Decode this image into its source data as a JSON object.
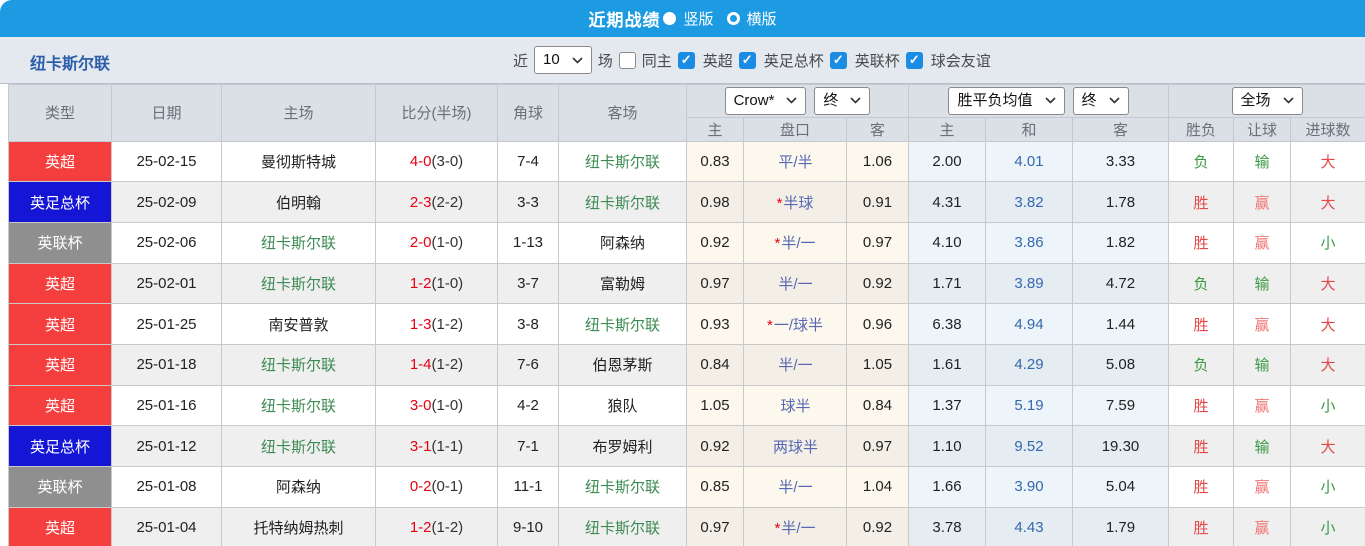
{
  "title_bar": {
    "title": "近期战绩",
    "vertical_label": "竖版",
    "horizontal_label": "横版"
  },
  "filter_bar": {
    "team": "纽卡斯尔联",
    "recent_label": "近",
    "recent_value": "10",
    "games_label": "场",
    "same_home_label": "同主",
    "competitions": [
      "英超",
      "英足总杯",
      "英联杯",
      "球会友谊"
    ]
  },
  "table": {
    "selects": {
      "company": "Crow*",
      "stage1": "终",
      "avg": "胜平负均值",
      "stage2": "终",
      "scope": "全场"
    },
    "left_headers": [
      "类型",
      "日期",
      "主场",
      "比分(半场)",
      "角球",
      "客场"
    ],
    "subheaders": [
      "主",
      "盘口",
      "客",
      "主",
      "和",
      "客",
      "胜负",
      "让球",
      "进球数"
    ],
    "rows": [
      {
        "league": "英超",
        "league_key": "premier",
        "date": "25-02-15",
        "home": "曼彻斯特城",
        "home_is_focus": false,
        "score": "4-0",
        "half": "(3-0)",
        "corners": "7-4",
        "away": "纽卡斯尔联",
        "away_is_focus": true,
        "crow_home": "0.83",
        "handicap_star": false,
        "handicap": "平/半",
        "crow_away": "1.06",
        "avg_win": "2.00",
        "avg_draw": "4.01",
        "avg_lose": "3.33",
        "result": "负",
        "handicap_result": "输",
        "goals": "大"
      },
      {
        "league": "英足总杯",
        "league_key": "facup",
        "date": "25-02-09",
        "home": "伯明翰",
        "home_is_focus": false,
        "score": "2-3",
        "half": "(2-2)",
        "corners": "3-3",
        "away": "纽卡斯尔联",
        "away_is_focus": true,
        "crow_home": "0.98",
        "handicap_star": true,
        "handicap": "半球",
        "crow_away": "0.91",
        "avg_win": "4.31",
        "avg_draw": "3.82",
        "avg_lose": "1.78",
        "result": "胜",
        "handicap_result": "赢",
        "goals": "大"
      },
      {
        "league": "英联杯",
        "league_key": "eflcup",
        "date": "25-02-06",
        "home": "纽卡斯尔联",
        "home_is_focus": true,
        "score": "2-0",
        "half": "(1-0)",
        "corners": "1-13",
        "away": "阿森纳",
        "away_is_focus": false,
        "crow_home": "0.92",
        "handicap_star": true,
        "handicap": "半/一",
        "crow_away": "0.97",
        "avg_win": "4.10",
        "avg_draw": "3.86",
        "avg_lose": "1.82",
        "result": "胜",
        "handicap_result": "赢",
        "goals": "小"
      },
      {
        "league": "英超",
        "league_key": "premier",
        "date": "25-02-01",
        "home": "纽卡斯尔联",
        "home_is_focus": true,
        "score": "1-2",
        "half": "(1-0)",
        "corners": "3-7",
        "away": "富勒姆",
        "away_is_focus": false,
        "crow_home": "0.97",
        "handicap_star": false,
        "handicap": "半/一",
        "crow_away": "0.92",
        "avg_win": "1.71",
        "avg_draw": "3.89",
        "avg_lose": "4.72",
        "result": "负",
        "handicap_result": "输",
        "goals": "大"
      },
      {
        "league": "英超",
        "league_key": "premier",
        "date": "25-01-25",
        "home": "南安普敦",
        "home_is_focus": false,
        "score": "1-3",
        "half": "(1-2)",
        "corners": "3-8",
        "away": "纽卡斯尔联",
        "away_is_focus": true,
        "crow_home": "0.93",
        "handicap_star": true,
        "handicap": "一/球半",
        "crow_away": "0.96",
        "avg_win": "6.38",
        "avg_draw": "4.94",
        "avg_lose": "1.44",
        "result": "胜",
        "handicap_result": "赢",
        "goals": "大"
      },
      {
        "league": "英超",
        "league_key": "premier",
        "date": "25-01-18",
        "home": "纽卡斯尔联",
        "home_is_focus": true,
        "score": "1-4",
        "half": "(1-2)",
        "corners": "7-6",
        "away": "伯恩茅斯",
        "away_is_focus": false,
        "crow_home": "0.84",
        "handicap_star": false,
        "handicap": "半/一",
        "crow_away": "1.05",
        "avg_win": "1.61",
        "avg_draw": "4.29",
        "avg_lose": "5.08",
        "result": "负",
        "handicap_result": "输",
        "goals": "大"
      },
      {
        "league": "英超",
        "league_key": "premier",
        "date": "25-01-16",
        "home": "纽卡斯尔联",
        "home_is_focus": true,
        "score": "3-0",
        "half": "(1-0)",
        "corners": "4-2",
        "away": "狼队",
        "away_is_focus": false,
        "crow_home": "1.05",
        "handicap_star": false,
        "handicap": "球半",
        "crow_away": "0.84",
        "avg_win": "1.37",
        "avg_draw": "5.19",
        "avg_lose": "7.59",
        "result": "胜",
        "handicap_result": "赢",
        "goals": "小"
      },
      {
        "league": "英足总杯",
        "league_key": "facup",
        "date": "25-01-12",
        "home": "纽卡斯尔联",
        "home_is_focus": true,
        "score": "3-1",
        "half": "(1-1)",
        "corners": "7-1",
        "away": "布罗姆利",
        "away_is_focus": false,
        "crow_home": "0.92",
        "handicap_star": false,
        "handicap": "两球半",
        "crow_away": "0.97",
        "avg_win": "1.10",
        "avg_draw": "9.52",
        "avg_lose": "19.30",
        "result": "胜",
        "handicap_result": "输",
        "goals": "大"
      },
      {
        "league": "英联杯",
        "league_key": "eflcup",
        "date": "25-01-08",
        "home": "阿森纳",
        "home_is_focus": false,
        "score": "0-2",
        "half": "(0-1)",
        "corners": "11-1",
        "away": "纽卡斯尔联",
        "away_is_focus": true,
        "crow_home": "0.85",
        "handicap_star": false,
        "handicap": "半/一",
        "crow_away": "1.04",
        "avg_win": "1.66",
        "avg_draw": "3.90",
        "avg_lose": "5.04",
        "result": "胜",
        "handicap_result": "赢",
        "goals": "小"
      },
      {
        "league": "英超",
        "league_key": "premier",
        "date": "25-01-04",
        "home": "托特纳姆热刺",
        "home_is_focus": false,
        "score": "1-2",
        "half": "(1-2)",
        "corners": "9-10",
        "away": "纽卡斯尔联",
        "away_is_focus": true,
        "crow_home": "0.97",
        "handicap_star": true,
        "handicap": "半/一",
        "crow_away": "0.92",
        "avg_win": "3.78",
        "avg_draw": "4.43",
        "avg_lose": "1.79",
        "result": "胜",
        "handicap_result": "赢",
        "goals": "小"
      }
    ]
  },
  "colors": {
    "top_bar": "#1d9be2",
    "filter_bar_bg": "#e4e9f0",
    "header_bg": "#dbdfe6",
    "header_grid": "#c3c9d1",
    "grid": "#c9c9c9",
    "row_alt_bg": "#efefef",
    "badge_premier": "#f53e3e",
    "badge_facup": "#1515d6",
    "badge_eflcup": "#8f8f8f",
    "focus_team": "#3d8b52",
    "score_red": "#e60012",
    "handicap_blue": "#5668b1",
    "draw_blue": "#3568ad",
    "win_red": "#e64747",
    "cover_pink": "#f17575",
    "lose_green": "#3a9a43",
    "title_blue": "#2d5fa9",
    "checkbox_blue": "#1b8ce3",
    "cream_bg": "#fdf8ee",
    "cream_bg_alt": "#f3efe6",
    "blue_bg": "#edf5fa",
    "blue_bg_alt": "#e5edf3"
  }
}
